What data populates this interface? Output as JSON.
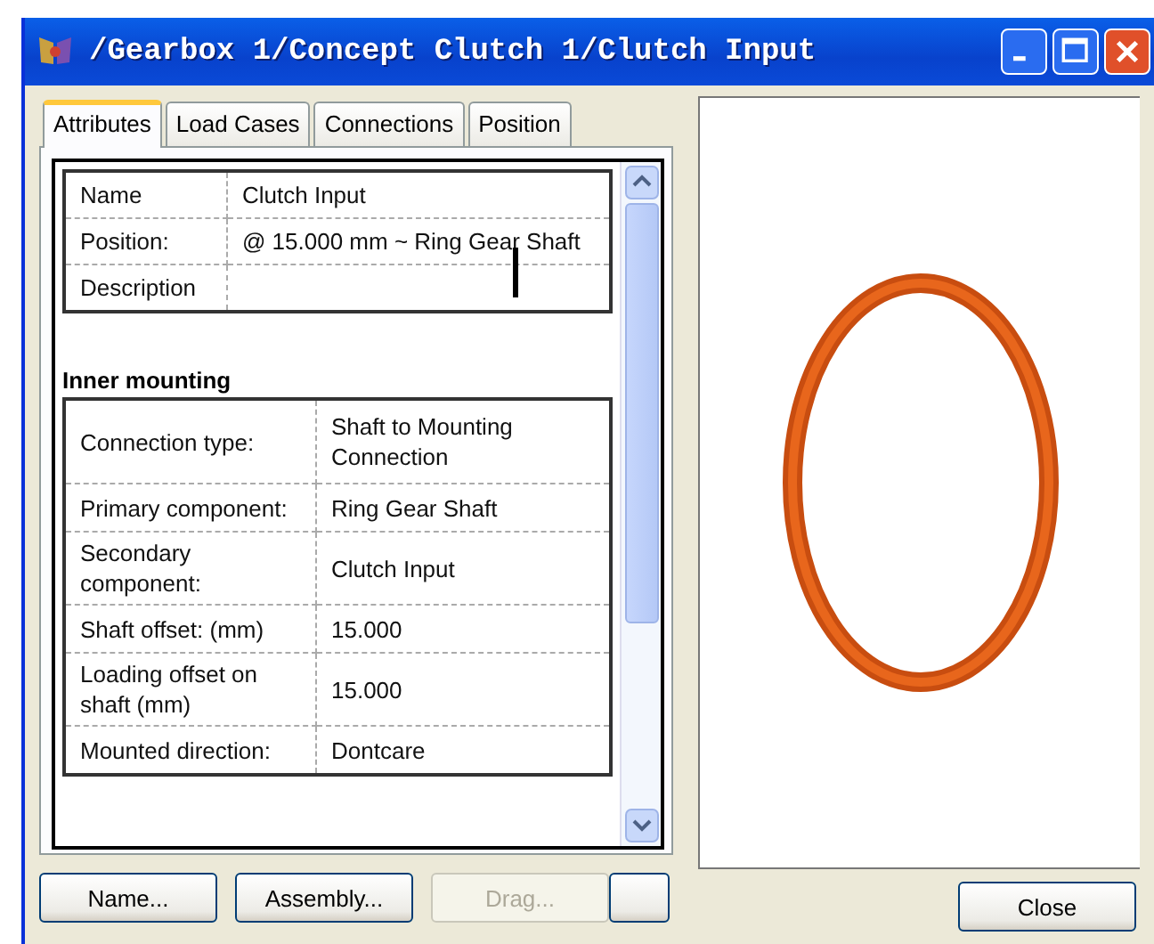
{
  "window": {
    "title": "/Gearbox 1/Concept Clutch 1/Clutch Input"
  },
  "tabs": [
    {
      "label": "Attributes",
      "selected": true
    },
    {
      "label": "Load Cases",
      "selected": false
    },
    {
      "label": "Connections",
      "selected": false
    },
    {
      "label": "Position",
      "selected": false
    }
  ],
  "general": [
    {
      "label": "Name",
      "value": "Clutch Input"
    },
    {
      "label": "Position:",
      "value": "@ 15.000 mm ~ Ring Gear Shaft"
    },
    {
      "label": "Description"
    }
  ],
  "inner_mounting": {
    "heading": "Inner mounting",
    "rows": [
      {
        "label": "Connection type:",
        "value": "Shaft to Mounting Connection"
      },
      {
        "label": "Primary component:",
        "value": "Ring Gear Shaft"
      },
      {
        "label": "Secondary component:",
        "value": "Clutch Input"
      },
      {
        "label": "Shaft offset: (mm)",
        "value": "15.000"
      },
      {
        "label": "Loading offset on shaft (mm)",
        "value": "15.000"
      },
      {
        "label": "Mounted direction:",
        "value": "Dontcare"
      }
    ]
  },
  "buttons": [
    {
      "label": "Name...",
      "disabled": false
    },
    {
      "label": "Assembly...",
      "disabled": false
    },
    {
      "label": "Drag...",
      "disabled": true
    }
  ],
  "close_button": {
    "label": "Close"
  }
}
